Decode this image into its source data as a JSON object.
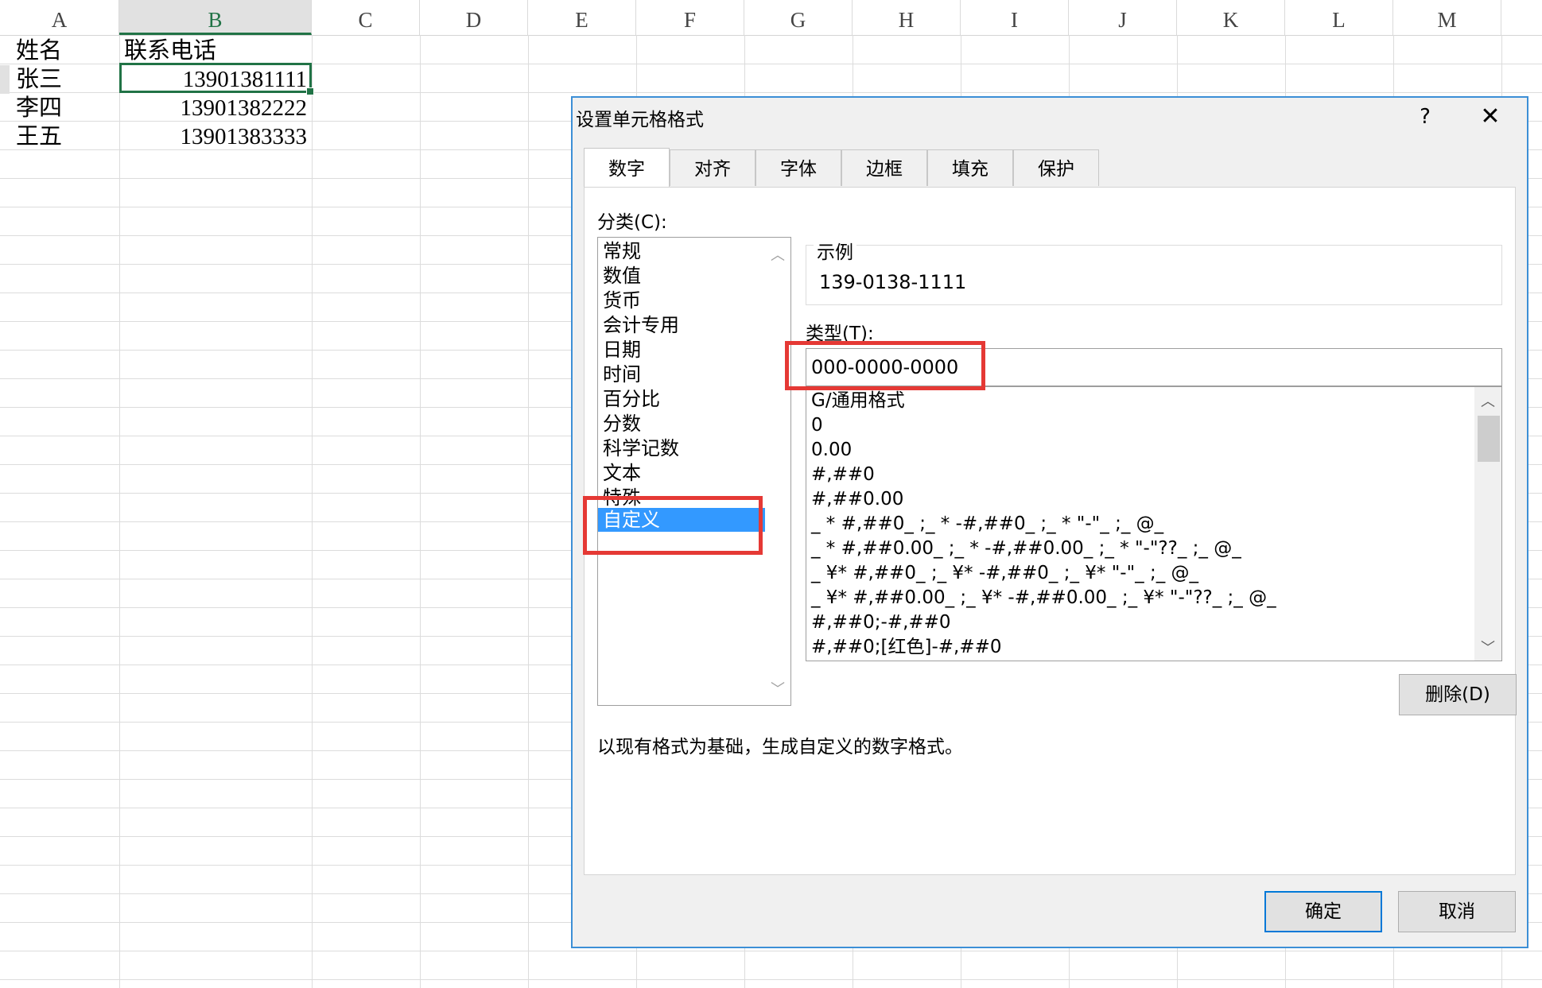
{
  "sheet": {
    "columns": [
      "A",
      "B",
      "C",
      "D",
      "E",
      "F",
      "G",
      "H",
      "I",
      "J",
      "K",
      "L",
      "M"
    ],
    "active_column": "B",
    "rows": [
      {
        "name": "姓名",
        "phone": "联系电话"
      },
      {
        "name": "张三",
        "phone": "13901381111"
      },
      {
        "name": "李四",
        "phone": "13901382222"
      },
      {
        "name": "王五",
        "phone": "13901383333"
      }
    ]
  },
  "dialog": {
    "title": "设置单元格格式",
    "help": "?",
    "close": "✕",
    "tabs": [
      "数字",
      "对齐",
      "字体",
      "边框",
      "填充",
      "保护"
    ],
    "active_tab": "数字",
    "category_label": "分类(C):",
    "categories": [
      "常规",
      "数值",
      "货币",
      "会计专用",
      "日期",
      "时间",
      "百分比",
      "分数",
      "科学记数",
      "文本",
      "特殊",
      "自定义"
    ],
    "selected_category": "自定义",
    "example_label": "示例",
    "example_value": "139-0138-1111",
    "type_label": "类型(T):",
    "type_value": "000-0000-0000",
    "formats": [
      "G/通用格式",
      "0",
      "0.00",
      "#,##0",
      "#,##0.00",
      "_ * #,##0_ ;_ * -#,##0_ ;_ * \"-\"_ ;_ @_",
      "_ * #,##0.00_ ;_ * -#,##0.00_ ;_ * \"-\"??_ ;_ @_",
      "_ ¥* #,##0_ ;_ ¥* -#,##0_ ;_ ¥* \"-\"_ ;_ @_",
      "_ ¥* #,##0.00_ ;_ ¥* -#,##0.00_ ;_ ¥* \"-\"??_ ;_ @_",
      "#,##0;-#,##0",
      "#,##0;[红色]-#,##0"
    ],
    "delete_button": "删除(D)",
    "description": "以现有格式为基础，生成自定义的数字格式。",
    "ok_button": "确定",
    "cancel_button": "取消"
  },
  "colors": {
    "excel_green": "#217346",
    "dialog_border": "#3c8fd6",
    "selection_blue": "#3399ff",
    "highlight_red": "#e53935"
  }
}
